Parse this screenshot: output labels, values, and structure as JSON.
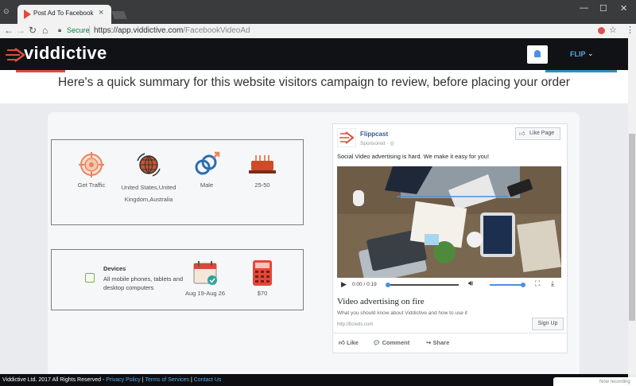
{
  "browser": {
    "tab_title": "Post Ad To Facebook",
    "tab_close": "×",
    "secure_label": "Secure",
    "url_host": "https://app.viddictive.com",
    "url_path": "/FacebookVideoAd",
    "window_controls": [
      "—",
      "☐",
      "✕"
    ]
  },
  "app": {
    "logo": "viddictive",
    "user": "FLIP",
    "caret": "⌄"
  },
  "summary": {
    "headline": "Here's a quick summary for this website visitors campaign to review, before placing your order"
  },
  "targeting": {
    "items": [
      {
        "icon": "target-icon",
        "label": "Get Traffic"
      },
      {
        "icon": "globe-icon",
        "label": "United States,United Kingdom,Australia"
      },
      {
        "icon": "gender-icon",
        "label": "Male"
      },
      {
        "icon": "birthday-cake-icon",
        "label": "25-50"
      }
    ]
  },
  "order": {
    "devices_title": "Devices",
    "devices_desc": "All mobile phones, tablets and desktop computers",
    "dates": "Aug 19-Aug 26",
    "price": "$70"
  },
  "ad": {
    "page_name": "Flippcast",
    "sponsored": "Sponsored · ",
    "like_page": "Like Page",
    "text": "Social Video advertising is hard. We make it easy for you!",
    "time": "0:00 / 0:19",
    "headline": "Video advertising on fire",
    "description": "What you should know about Viddictive and how to use it",
    "link": "http://bcieds.com",
    "cta": "Sign Up",
    "actions": [
      "Like",
      "Comment",
      "Share"
    ]
  },
  "footer": {
    "copyright": "Viddictive Ltd. 2017 All Rights Reserved -",
    "links": [
      "Privacy Policy",
      "Terms of Services",
      "Contact Us"
    ],
    "corner_text": "Now recording"
  },
  "colors": {
    "accent_blue": "#2d8fc4",
    "accent_red": "#e24a3b",
    "fb_blue": "#365899"
  }
}
